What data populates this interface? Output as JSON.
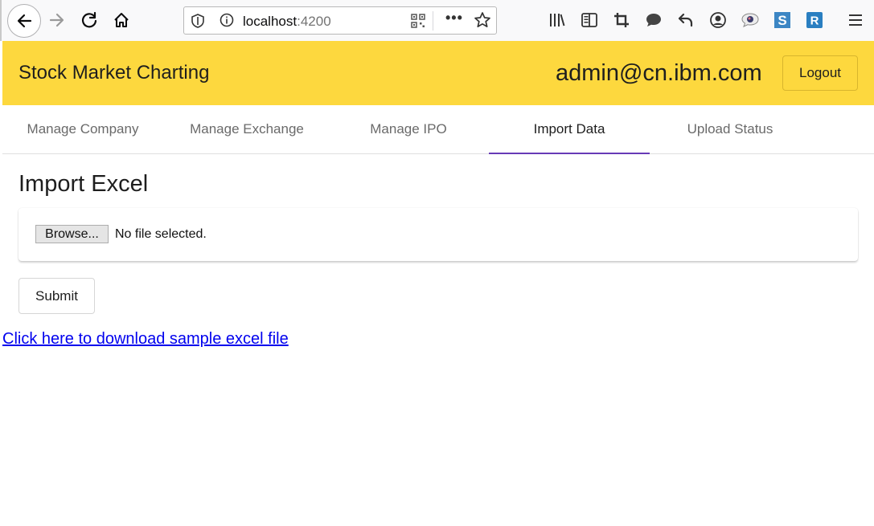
{
  "browser": {
    "url_host": "localhost",
    "url_port": ":4200",
    "menu_dots": "•••"
  },
  "header": {
    "app_title": "Stock Market Charting",
    "user_email": "admin@cn.ibm.com",
    "logout_label": "Logout",
    "background_color": "#fdd83e"
  },
  "tabs": [
    {
      "label": "Manage Company",
      "active": false
    },
    {
      "label": "Manage Exchange",
      "active": false
    },
    {
      "label": "Manage IPO",
      "active": false
    },
    {
      "label": "Import Data",
      "active": true
    },
    {
      "label": "Upload Status",
      "active": false
    }
  ],
  "tab_indicator_color": "#673ab7",
  "main": {
    "page_title": "Import Excel",
    "browse_label": "Browse...",
    "file_status": "No file selected.",
    "submit_label": "Submit",
    "download_link": "Click here to download sample excel file"
  },
  "icons": [
    "back-icon",
    "forward-icon",
    "reload-icon",
    "home-icon",
    "shield-icon",
    "info-icon",
    "qr-code-icon",
    "bookmark-star-icon",
    "library-icon",
    "sidebar-icon",
    "crop-icon",
    "chat-icon",
    "undo-icon",
    "account-icon",
    "extension-icon",
    "s-extension-icon",
    "r-extension-icon",
    "hamburger-menu-icon"
  ]
}
